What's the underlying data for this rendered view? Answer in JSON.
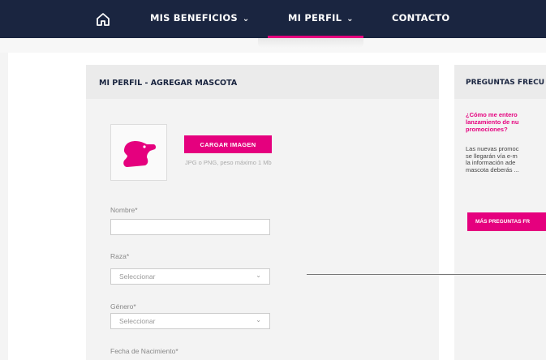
{
  "nav": {
    "home_icon": "home-icon",
    "items": [
      {
        "label": "MIS BENEFICIOS",
        "has_chevron": true
      },
      {
        "label": "MI PERFIL",
        "has_chevron": true
      },
      {
        "label": "CONTACTO",
        "has_chevron": false
      }
    ],
    "chevron": "⌄",
    "active_color": "#e5007e",
    "bg_color": "#1a2540"
  },
  "main": {
    "title": "MI PERFIL - AGREGAR MASCOTA",
    "avatar_icon": "dog-icon",
    "upload_label": "CARGAR IMAGEN",
    "upload_hint": "JPG o PNG, peso máximo 1 Mb",
    "fields": {
      "name_label": "Nombre*",
      "name_value": "",
      "breed_label": "Raza*",
      "breed_value": "Seleccionar",
      "gender_label": "Género*",
      "gender_value": "Seleccionar",
      "birth_label": "Fecha de Nacimiento*"
    }
  },
  "sidebar": {
    "title": "PREGUNTAS FRECU",
    "question": "¿Cómo me entero\nlanzamiento de nu\npromociones?",
    "answer": "Las nuevas promoc\nse llegarán vía e-m\nla información ade\nmascota deberás ...",
    "more_button": "MÁS PREGUNTAS FR"
  }
}
